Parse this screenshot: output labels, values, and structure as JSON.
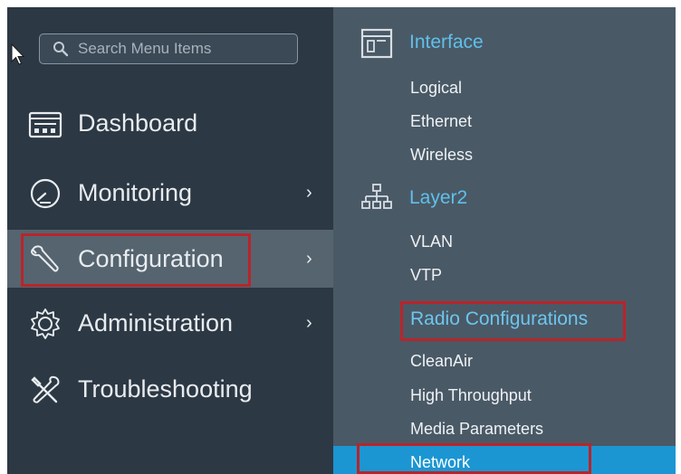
{
  "search": {
    "placeholder": "Search Menu Items"
  },
  "nav": {
    "items": [
      {
        "label": "Dashboard",
        "icon": "dashboard-icon"
      },
      {
        "label": "Monitoring",
        "icon": "gauge-icon",
        "chevron": "›"
      },
      {
        "label": "Configuration",
        "icon": "wrench-icon",
        "chevron": "›",
        "active": true
      },
      {
        "label": "Administration",
        "icon": "gear-icon",
        "chevron": "›"
      },
      {
        "label": "Troubleshooting",
        "icon": "tools-icon"
      }
    ]
  },
  "submenu": {
    "interface": {
      "title": "Interface",
      "items": [
        "Logical",
        "Ethernet",
        "Wireless"
      ]
    },
    "layer2": {
      "title": "Layer2",
      "items": [
        "VLAN",
        "VTP"
      ]
    },
    "radio": {
      "title": "Radio Configurations",
      "items": [
        "CleanAir",
        "High Throughput",
        "Media Parameters",
        "Network"
      ]
    }
  },
  "colors": {
    "left_panel": "#2c3844",
    "right_panel": "#4a5966",
    "active_row": "#55646f",
    "section_heading": "#5fc0ea",
    "selected_row": "#1b96d3",
    "highlight_box": "#b9242a"
  }
}
